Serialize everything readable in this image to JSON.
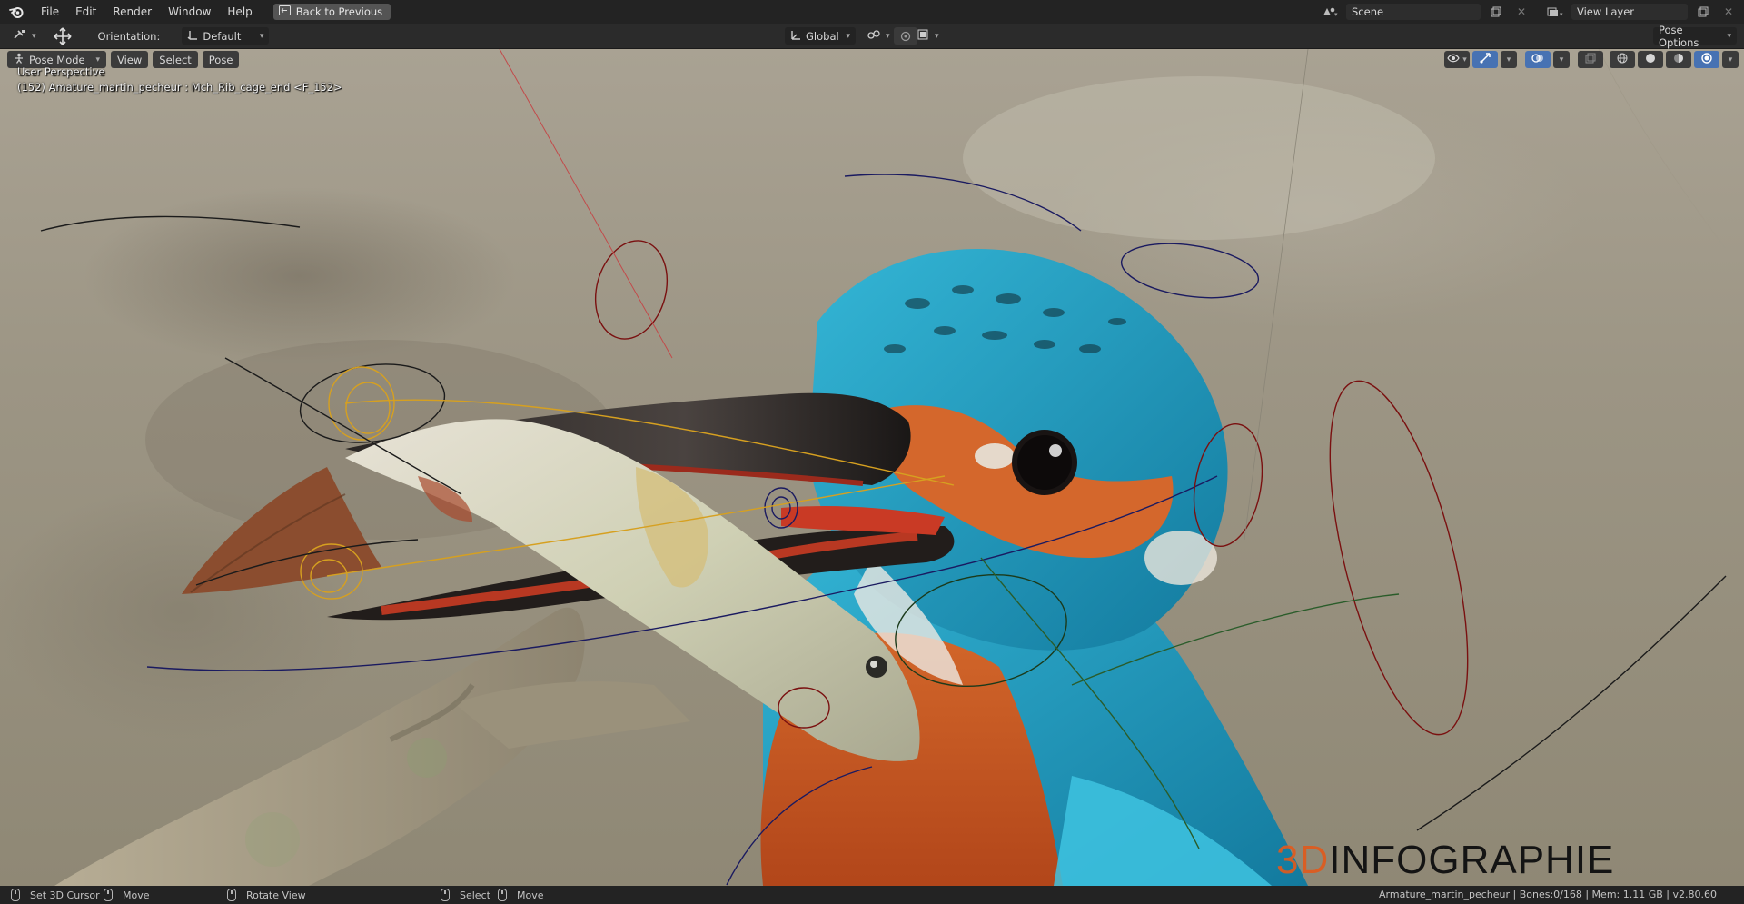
{
  "topbar": {
    "menus": [
      "File",
      "Edit",
      "Render",
      "Window",
      "Help"
    ],
    "back_button": "Back to Previous",
    "scene": "Scene",
    "view_layer": "View Layer"
  },
  "header": {
    "orientation_label": "Orientation:",
    "orientation_value": "Default",
    "transform_space": "Global",
    "pose_options": "Pose Options"
  },
  "viewport": {
    "mode": "Pose Mode",
    "menus": [
      "View",
      "Select",
      "Pose"
    ],
    "perspective": "User Perspective",
    "active_info": "(152) Amature_martin_pecheur : Mch_Rib_cage_end <F_152>",
    "watermark_3d": "3D",
    "watermark_rest": "INFOGRAPHIE"
  },
  "statusbar": {
    "set_cursor": "Set 3D Cursor",
    "move": "Move",
    "rotate_view": "Rotate View",
    "select": "Select",
    "move2": "Move",
    "stats": "Armature_martin_pecheur | Bones:0/168 | Mem: 1.11 GB | v2.80.60"
  },
  "colors": {
    "accent": "#4772b3",
    "watermark_orange": "#e25a1c"
  }
}
